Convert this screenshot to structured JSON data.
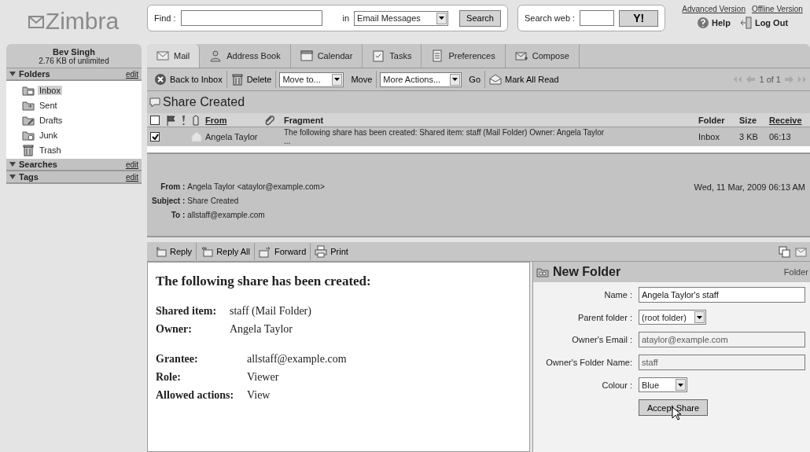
{
  "logo": {
    "text": "Zimbra"
  },
  "search": {
    "find_label": "Find :",
    "in_label": "in",
    "scope": "Email Messages",
    "button": "Search"
  },
  "web_search": {
    "label": "Search web :",
    "button": "Y!"
  },
  "top_links": [
    {
      "label": "Advanced Version"
    },
    {
      "label": "Offline Version"
    }
  ],
  "top_actions": [
    {
      "label": "Help",
      "kind": "help"
    },
    {
      "label": "Log Out",
      "kind": "logout"
    }
  ],
  "account": {
    "name": "Bev Singh",
    "quota": "2.76 KB of unlimited"
  },
  "sidebar": {
    "sections": [
      {
        "title": "Folders",
        "edit": "edit",
        "expanded": true,
        "items": [
          {
            "label": "Inbox",
            "kind": "inbox",
            "selected": true
          },
          {
            "label": "Sent",
            "kind": "sent",
            "selected": false
          },
          {
            "label": "Drafts",
            "kind": "drafts",
            "selected": false
          },
          {
            "label": "Junk",
            "kind": "junk",
            "selected": false
          },
          {
            "label": "Trash",
            "kind": "trash",
            "selected": false
          }
        ]
      },
      {
        "title": "Searches",
        "edit": "edit",
        "expanded": true
      },
      {
        "title": "Tags",
        "edit": "edit",
        "expanded": true
      }
    ]
  },
  "tabs": [
    {
      "label": "Mail",
      "kind": "mail",
      "selected": true
    },
    {
      "label": "Address Book",
      "kind": "contacts",
      "selected": false
    },
    {
      "label": "Calendar",
      "kind": "calendar",
      "selected": false
    },
    {
      "label": "Tasks",
      "kind": "tasks",
      "selected": false
    },
    {
      "label": "Preferences",
      "kind": "preferences",
      "selected": false
    },
    {
      "label": "Compose",
      "kind": "compose",
      "selected": false
    }
  ],
  "toolbar": {
    "back": "Back to Inbox",
    "delete": "Delete",
    "move_select": "Move to...",
    "move": "Move",
    "actions_select": "More Actions...",
    "go": "Go",
    "mark_read": "Mark All Read",
    "pager": "1 of 1"
  },
  "conversation_title": "Share Created",
  "list": {
    "header_checked": false,
    "columns": {
      "from": "From",
      "fragment": "Fragment",
      "folder": "Folder",
      "size": "Size",
      "received": "Receive"
    },
    "rows": [
      {
        "checked": true,
        "from": "Angela Taylor",
        "fragment": "The following share has been created: Shared item: staff (Mail Folder) Owner: Angela Taylor",
        "more": "...",
        "folder": "Inbox",
        "size": "3 KB",
        "received": "06:13"
      }
    ]
  },
  "message_header": {
    "from_label": "From :",
    "from": "Angela Taylor <ataylor@example.com>",
    "subject_label": "Subject :",
    "subject": "Share Created",
    "to_label": "To :",
    "to": "allstaff@example.com",
    "date": "Wed, 11 Mar, 2009 06:13 AM"
  },
  "message_actions": [
    {
      "label": "Reply",
      "kind": "reply"
    },
    {
      "label": "Reply All",
      "kind": "reply_all"
    },
    {
      "label": "Forward",
      "kind": "forward"
    },
    {
      "label": "Print",
      "kind": "print"
    }
  ],
  "message_body": {
    "heading": "The following share has been created:",
    "groups": [
      [
        {
          "label": "Shared item:",
          "value": "staff (Mail Folder)"
        },
        {
          "label": "Owner:",
          "value": "Angela Taylor"
        }
      ],
      [
        {
          "label": "Grantee:",
          "value": "allstaff@example.com"
        },
        {
          "label": "Role:",
          "value": "Viewer"
        },
        {
          "label": "Allowed actions:",
          "value": "View"
        }
      ]
    ]
  },
  "share_panel": {
    "title": "New Folder",
    "side_label": "Folder",
    "fields": [
      {
        "label": "Name :",
        "kind": "input",
        "value": "Angela Taylor's staff",
        "disabled": false
      },
      {
        "label": "Parent folder :",
        "kind": "select",
        "value": "(root folder)",
        "disabled": false
      },
      {
        "label": "Owner's Email :",
        "kind": "input",
        "value": "ataylor@example.com",
        "disabled": true
      },
      {
        "label": "Owner's Folder Name:",
        "kind": "input",
        "value": "staff",
        "disabled": true
      },
      {
        "label": "Colour :",
        "kind": "select",
        "value": "Blue",
        "disabled": false
      }
    ],
    "button": "Accept Share"
  }
}
